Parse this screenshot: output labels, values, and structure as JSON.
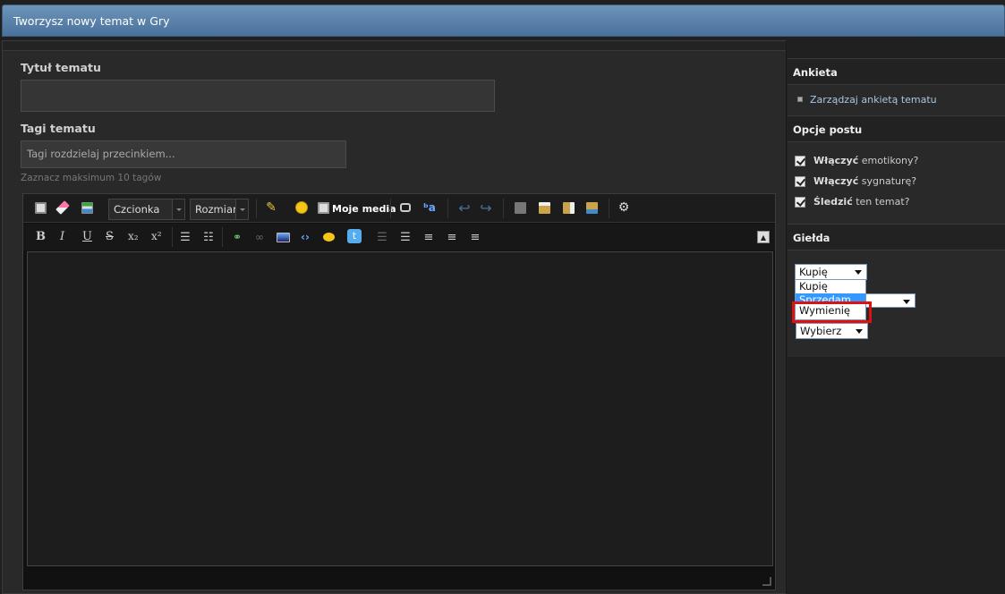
{
  "header": {
    "title": "Tworzysz nowy temat w Gry"
  },
  "form": {
    "title_label": "Tytuł tematu",
    "title_value": "",
    "tags_label": "Tagi tematu",
    "tags_placeholder": "Tagi rozdzielaj przecinkiem...",
    "tags_hint": "Zaznacz maksimum 10 tagów"
  },
  "editor": {
    "font_select": "Czcionka",
    "size_select": "Rozmiar",
    "media_button": "Moje media",
    "format": {
      "bold": "B",
      "italic": "I",
      "underline": "U",
      "strike": "S",
      "sub": "x₂",
      "sup": "x²"
    },
    "content": ""
  },
  "sidebar": {
    "poll": {
      "heading": "Ankieta",
      "link": "Zarządzaj ankietą tematu"
    },
    "options": {
      "heading": "Opcje postu",
      "items": [
        {
          "bold": "Włączyć",
          "rest": " emotikony?",
          "checked": true
        },
        {
          "bold": "Włączyć",
          "rest": " sygnaturę?",
          "checked": true
        },
        {
          "bold": "Śledzić",
          "rest": " ten temat?",
          "checked": true
        }
      ]
    },
    "exchange": {
      "heading": "Giełda",
      "select_value": "Kupię",
      "dropdown_options": [
        "Kupię",
        "Sprzedam",
        "Wymienię"
      ],
      "highlighted_option": "Sprzedam",
      "second_select": "Wybierz"
    }
  },
  "colors": {
    "header_bg": "#5b83aa",
    "highlight": "#3399ff",
    "annotation": "#e01010"
  }
}
